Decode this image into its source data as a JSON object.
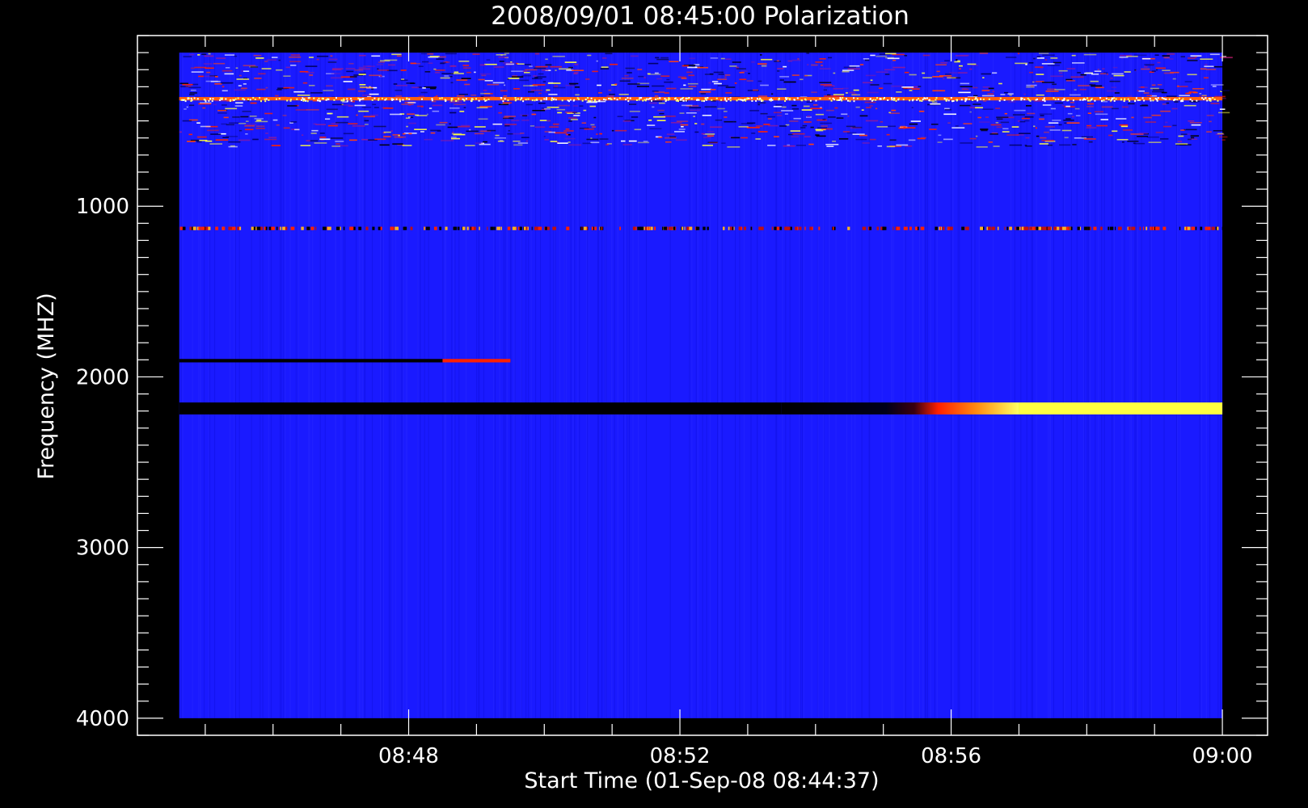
{
  "chart_data": {
    "type": "heatmap",
    "title": "2008/09/01 08:45:00 Polarization",
    "xlabel": "Start Time (01-Sep-08 08:44:37)",
    "ylabel": "Frequency (MHZ)",
    "x_start": "08:44:37",
    "x_end": "09:00:00",
    "xlim": [
      "08:44:00",
      "09:00:40"
    ],
    "ylim": [
      4100,
      0
    ],
    "y_inverted": true,
    "x_ticks": [
      "08:48",
      "08:52",
      "08:56",
      "09:00"
    ],
    "y_ticks": [
      1000,
      2000,
      3000,
      4000
    ],
    "frequency_range_mhz": [
      100,
      4000
    ],
    "colormap": [
      "#000000",
      "#1a1aff",
      "#ff2000",
      "#ffff40",
      "#ffffff"
    ],
    "background_level_color": "#1a1aff",
    "grid": false,
    "features": [
      {
        "freq_mhz": [
          100,
          650
        ],
        "t_start": "08:44:37",
        "t_end": "09:00:00",
        "kind": "noisy interference band",
        "level": "mixed"
      },
      {
        "freq_mhz": [
          360,
          380
        ],
        "t_start": "08:44:37",
        "t_end": "09:00:00",
        "kind": "bright line",
        "level": "high"
      },
      {
        "freq_mhz": [
          1120,
          1140
        ],
        "t_start": "08:44:37",
        "t_end": "09:00:00",
        "kind": "dashed interference line",
        "level": "mixed"
      },
      {
        "freq_mhz": [
          1895,
          1915
        ],
        "t_start": "08:44:37",
        "t_end": "08:48:30",
        "kind": "line",
        "level": "low"
      },
      {
        "freq_mhz": [
          1895,
          1915
        ],
        "t_start": "08:48:30",
        "t_end": "08:49:30",
        "kind": "line",
        "level": "medium"
      },
      {
        "freq_mhz": [
          2150,
          2220
        ],
        "t_start": "08:44:37",
        "t_end": "08:53:30",
        "kind": "band",
        "level": "low"
      },
      {
        "freq_mhz": [
          2150,
          2220
        ],
        "t_start": "08:53:30",
        "t_end": "08:57:00",
        "kind": "band",
        "level": "medium"
      },
      {
        "freq_mhz": [
          2150,
          2220
        ],
        "t_start": "08:57:00",
        "t_end": "09:00:00",
        "kind": "band",
        "level": "high"
      }
    ]
  }
}
